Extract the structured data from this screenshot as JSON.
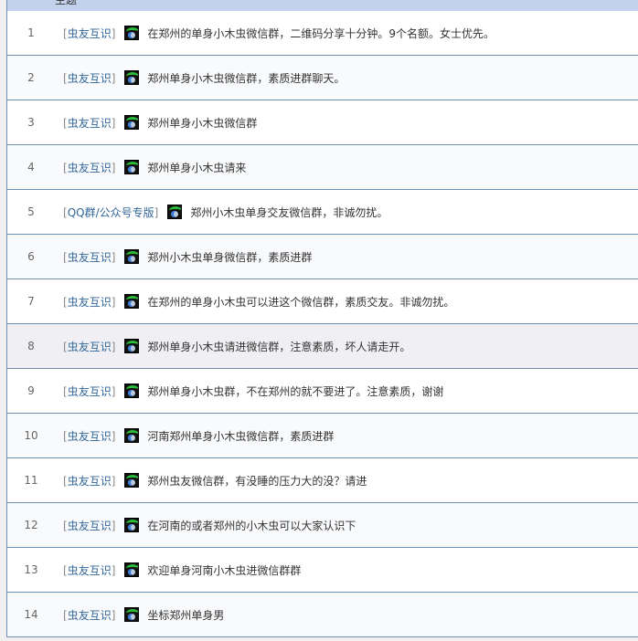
{
  "header": {
    "title_col": "主题"
  },
  "rows": [
    {
      "num": "1",
      "category": "虫友互识",
      "title": "在郑州的单身小木虫微信群，二维码分享十分钟。9个名额。女士优先。"
    },
    {
      "num": "2",
      "category": "虫友互识",
      "title": "郑州单身小木虫微信群，素质进群聊天。"
    },
    {
      "num": "3",
      "category": "虫友互识",
      "title": "郑州单身小木虫微信群"
    },
    {
      "num": "4",
      "category": "虫友互识",
      "title": "郑州单身小木虫请来"
    },
    {
      "num": "5",
      "category": "QQ群/公众号专版",
      "title": "郑州小木虫单身交友微信群，非诚勿扰。"
    },
    {
      "num": "6",
      "category": "虫友互识",
      "title": "郑州小木虫单身微信群，素质进群"
    },
    {
      "num": "7",
      "category": "虫友互识",
      "title": "在郑州的单身小木虫可以进这个微信群，素质交友。非诚勿扰。"
    },
    {
      "num": "8",
      "category": "虫友互识",
      "title": "郑州单身小木虫请进微信群，注意素质，坏人请走开。"
    },
    {
      "num": "9",
      "category": "虫友互识",
      "title": "郑州单身小木虫群，不在郑州的就不要进了。注意素质，谢谢"
    },
    {
      "num": "10",
      "category": "虫友互识",
      "title": "河南郑州单身小木虫微信群，素质进群"
    },
    {
      "num": "11",
      "category": "虫友互识",
      "title": "郑州虫友微信群，有没睡的压力大的没？请进"
    },
    {
      "num": "12",
      "category": "虫友互识",
      "title": "在河南的或者郑州的小木虫可以大家认识下"
    },
    {
      "num": "13",
      "category": "虫友互识",
      "title": "欢迎单身河南小木虫进微信群群"
    },
    {
      "num": "14",
      "category": "虫友互识",
      "title": "坐标郑州单身男"
    }
  ]
}
